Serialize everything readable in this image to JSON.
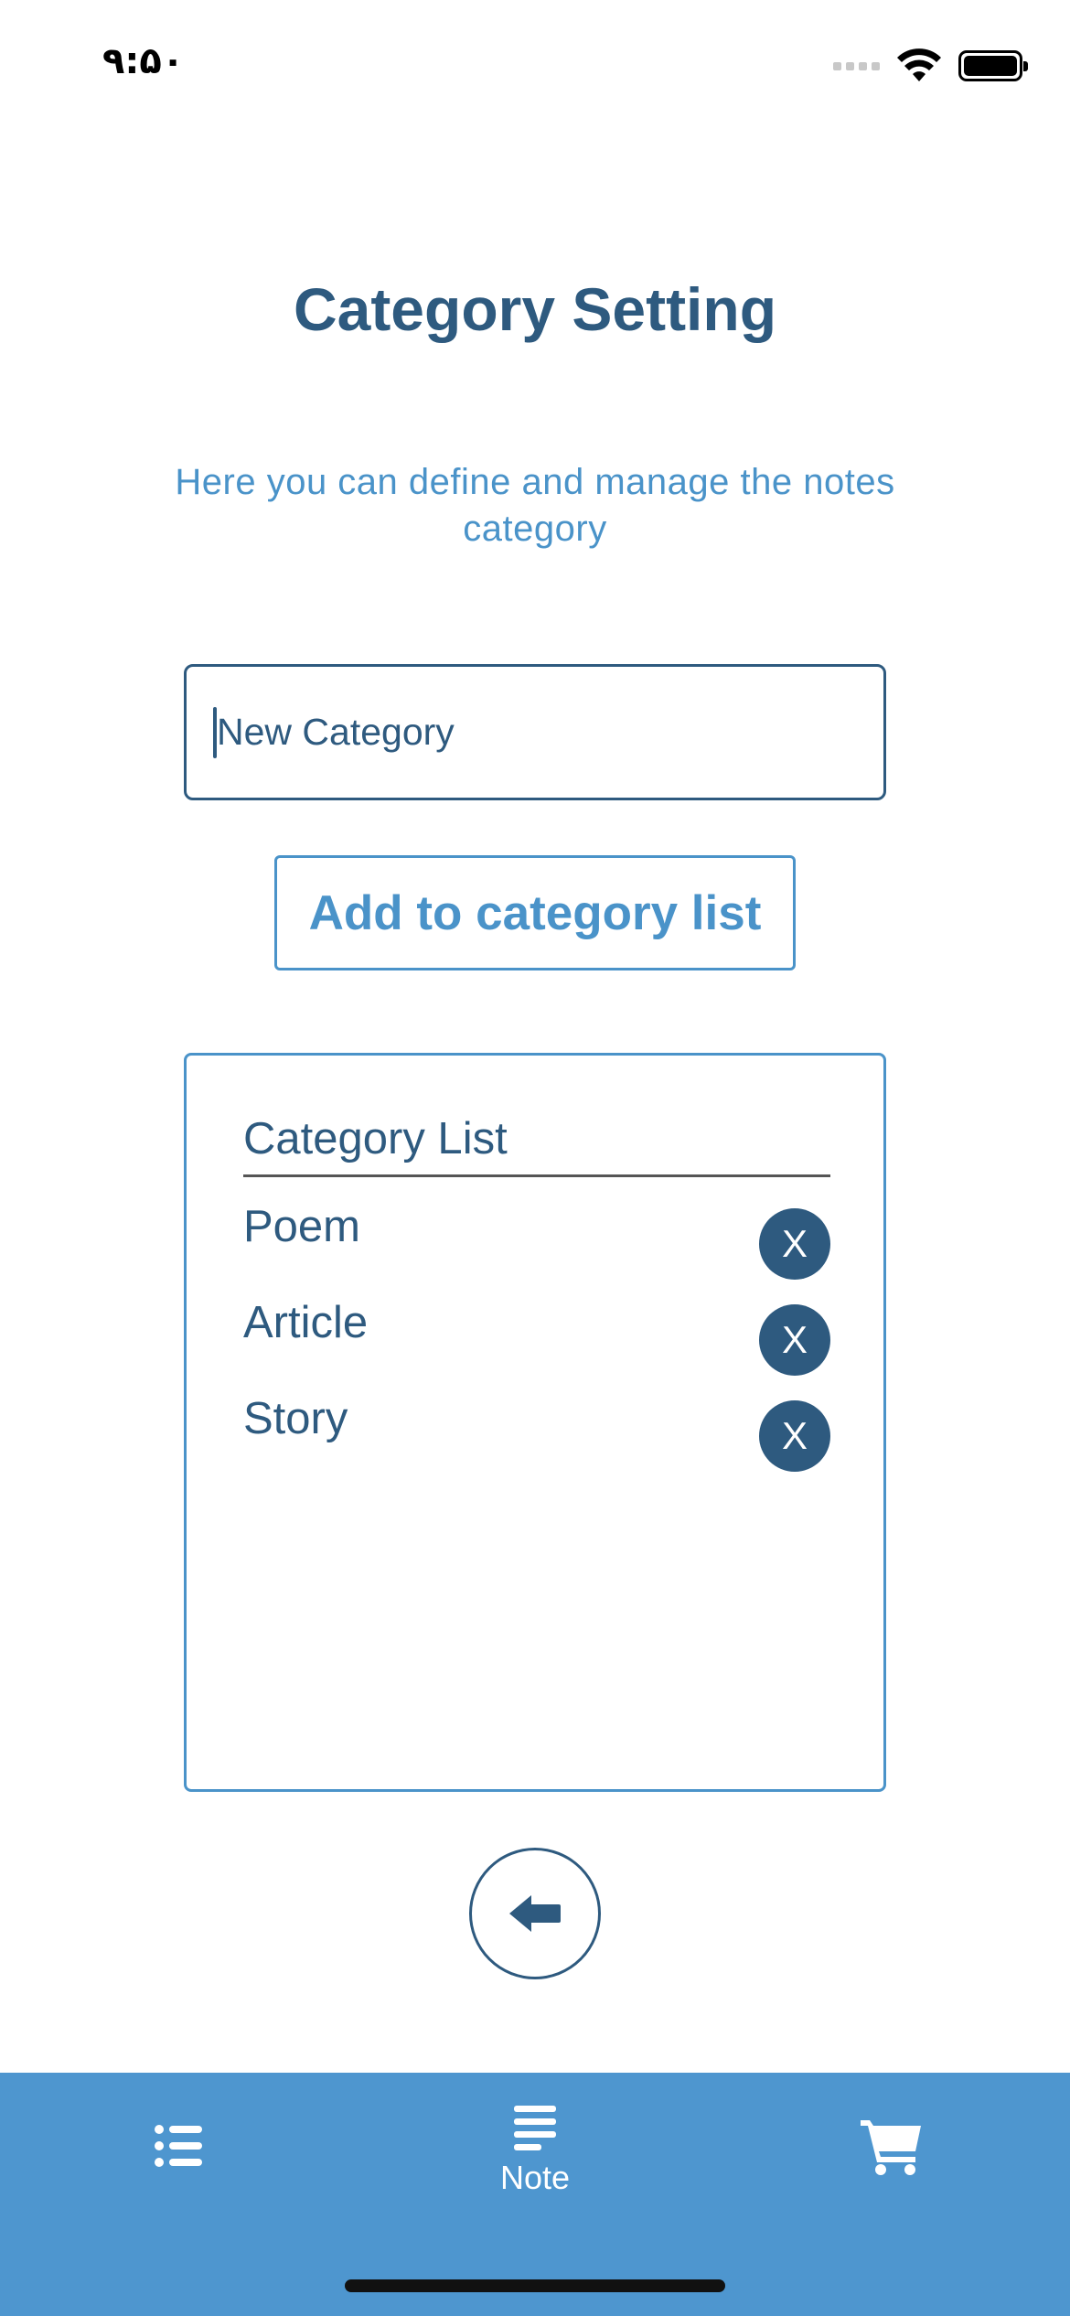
{
  "status_bar": {
    "time": "۹:۵۰"
  },
  "header": {
    "title": "Category Setting",
    "subtitle": "Here you can define and manage the notes category"
  },
  "form": {
    "input_placeholder": "New Category",
    "input_value": "",
    "add_button_label": "Add to category list"
  },
  "category_list": {
    "header": "Category List",
    "items": [
      {
        "label": "Poem",
        "delete_label": "X"
      },
      {
        "label": "Article",
        "delete_label": "X"
      },
      {
        "label": "Story",
        "delete_label": "X"
      }
    ]
  },
  "tab_bar": {
    "tabs": [
      {
        "icon": "list-icon",
        "label": ""
      },
      {
        "icon": "note-lines-icon",
        "label": "Note"
      },
      {
        "icon": "cart-icon",
        "label": ""
      }
    ]
  },
  "colors": {
    "primary_dark": "#2e5a7f",
    "accent": "#4a93c9",
    "tab_bar": "#4e96cf"
  }
}
